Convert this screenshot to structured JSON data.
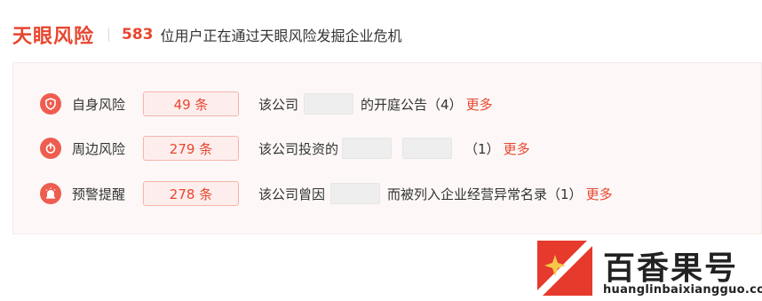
{
  "header": {
    "brand": "天眼风险",
    "user_count": "583",
    "subtitle": "位用户正在通过天眼风险发掘企业危机"
  },
  "rows": [
    {
      "icon": "shield-icon",
      "label": "自身风险",
      "count": "49 条",
      "prefix": "该公司",
      "suffix": "的开庭公告（4）",
      "more": "更多"
    },
    {
      "icon": "power-icon",
      "label": "周边风险",
      "count": "279 条",
      "prefix": "该公司投资的",
      "suffix": "（1）",
      "more": "更多"
    },
    {
      "icon": "alarm-icon",
      "label": "预警提醒",
      "count": "278 条",
      "prefix": "该公司曾因",
      "suffix": "而被列入企业经营异常名录（1）",
      "more": "更多"
    }
  ],
  "watermark": {
    "title": "百香果号",
    "url": "huanglinbaixiangguo.com"
  },
  "colors": {
    "accent": "#e8462f",
    "icon_bg": "#ee5d4f",
    "badge_bg": "#fdeeed",
    "panel_bg": "#fdf8f7"
  }
}
